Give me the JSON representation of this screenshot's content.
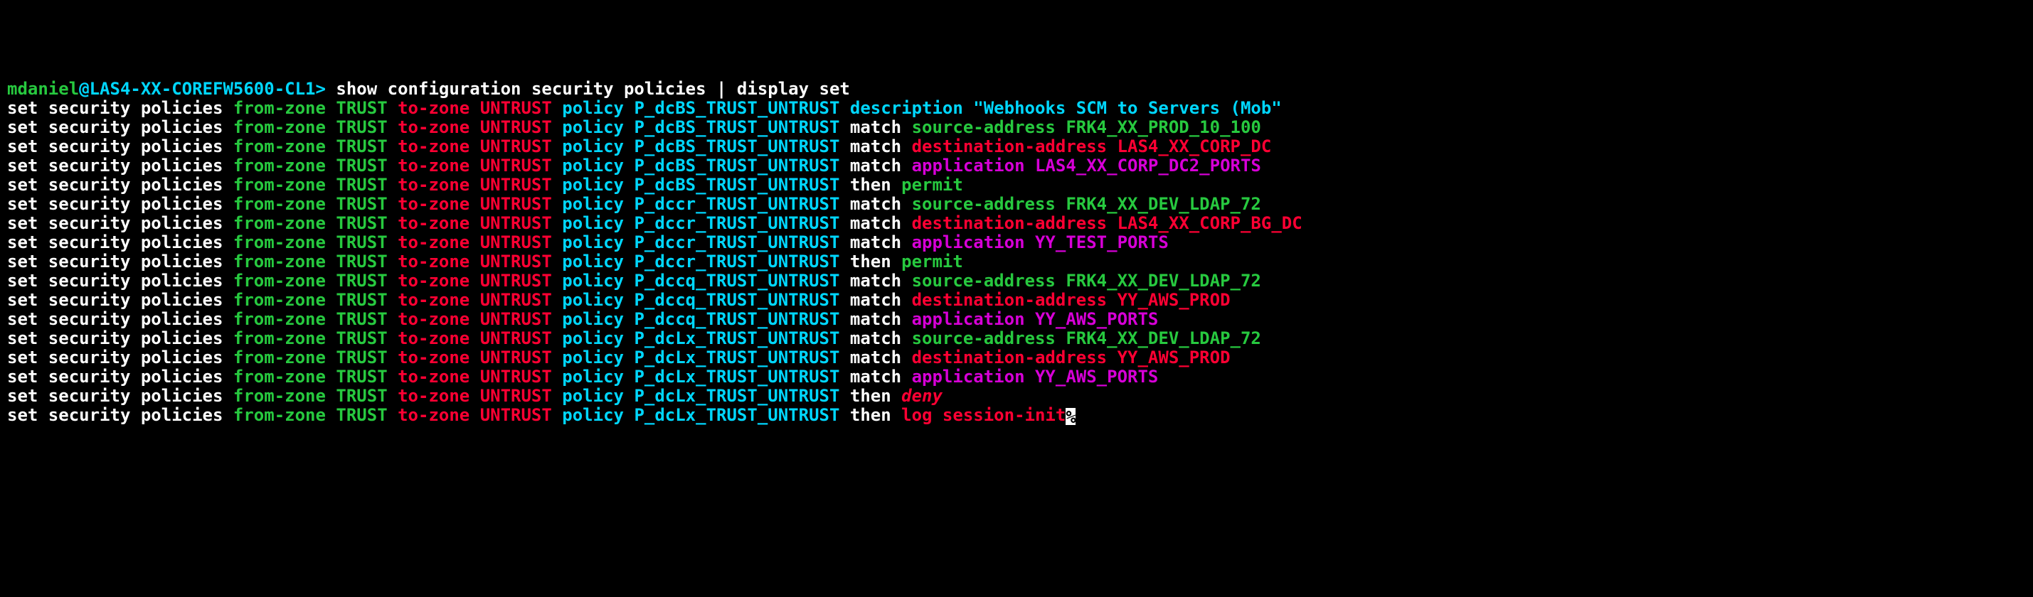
{
  "prompt": {
    "user": "mdaniel",
    "at": "@",
    "host": "LAS4-XX-COREFW5600-CL1",
    "caret": ">",
    "command": " show configuration security policies | display set"
  },
  "lines": [
    {
      "policy": "P_dcBS_TRUST_UNTRUST",
      "tail_kw": "description",
      "tail_val": "\"Webhooks SCM to Servers (Mob\"",
      "tail_kw_color": "cyan",
      "tail_val_color": "cyan"
    },
    {
      "policy": "P_dcBS_TRUST_UNTRUST",
      "mid": "match",
      "tail_kw": "source-address",
      "tail_val": "FRK4_XX_PROD_10_100",
      "tail_kw_color": "green",
      "tail_val_color": "green"
    },
    {
      "policy": "P_dcBS_TRUST_UNTRUST",
      "mid": "match",
      "tail_kw": "destination-address",
      "tail_val": "LAS4_XX_CORP_DC",
      "tail_kw_color": "red",
      "tail_val_color": "red"
    },
    {
      "policy": "P_dcBS_TRUST_UNTRUST",
      "mid": "match",
      "tail_kw": "application",
      "tail_val": "LAS4_XX_CORP_DC2_PORTS",
      "tail_kw_color": "magenta",
      "tail_val_color": "magenta"
    },
    {
      "policy": "P_dcBS_TRUST_UNTRUST",
      "mid": "then",
      "tail_kw": "permit",
      "tail_kw_color": "green"
    },
    {
      "policy": "P_dccr_TRUST_UNTRUST",
      "mid": "match",
      "tail_kw": "source-address",
      "tail_val": "FRK4_XX_DEV_LDAP_72",
      "tail_kw_color": "green",
      "tail_val_color": "green"
    },
    {
      "policy": "P_dccr_TRUST_UNTRUST",
      "mid": "match",
      "tail_kw": "destination-address",
      "tail_val": "LAS4_XX_CORP_BG_DC",
      "tail_kw_color": "red",
      "tail_val_color": "red"
    },
    {
      "policy": "P_dccr_TRUST_UNTRUST",
      "mid": "match",
      "tail_kw": "application",
      "tail_val": "YY_TEST_PORTS",
      "tail_kw_color": "magenta",
      "tail_val_color": "magenta"
    },
    {
      "policy": "P_dccr_TRUST_UNTRUST",
      "mid": "then",
      "tail_kw": "permit",
      "tail_kw_color": "green"
    },
    {
      "policy": "P_dccq_TRUST_UNTRUST",
      "mid": "match",
      "tail_kw": "source-address",
      "tail_val": "FRK4_XX_DEV_LDAP_72",
      "tail_kw_color": "green",
      "tail_val_color": "green"
    },
    {
      "policy": "P_dccq_TRUST_UNTRUST",
      "mid": "match",
      "tail_kw": "destination-address",
      "tail_val": "YY_AWS_PROD",
      "tail_kw_color": "red",
      "tail_val_color": "red"
    },
    {
      "policy": "P_dccq_TRUST_UNTRUST",
      "mid": "match",
      "tail_kw": "application",
      "tail_val": "YY_AWS_PORTS",
      "tail_kw_color": "magenta",
      "tail_val_color": "magenta"
    },
    {
      "policy": "P_dcLx_TRUST_UNTRUST",
      "mid": "match",
      "tail_kw": "source-address",
      "tail_val": "FRK4_XX_DEV_LDAP_72",
      "tail_kw_color": "green",
      "tail_val_color": "green"
    },
    {
      "policy": "P_dcLx_TRUST_UNTRUST",
      "mid": "match",
      "tail_kw": "destination-address",
      "tail_val": "YY_AWS_PROD",
      "tail_kw_color": "red",
      "tail_val_color": "red"
    },
    {
      "policy": "P_dcLx_TRUST_UNTRUST",
      "mid": "match",
      "tail_kw": "application",
      "tail_val": "YY_AWS_PORTS",
      "tail_kw_color": "magenta",
      "tail_val_color": "magenta"
    },
    {
      "policy": "P_dcLx_TRUST_UNTRUST",
      "mid": "then",
      "tail_kw": "deny",
      "tail_kw_color": "red-italic"
    },
    {
      "policy": "P_dcLx_TRUST_UNTRUST",
      "mid": "then",
      "tail_kw": "log session-init",
      "tail_kw_color": "red",
      "cursor": true
    }
  ],
  "common": {
    "set": "set",
    "security": "security",
    "policies": "policies",
    "from_zone": "from-zone",
    "trust": "TRUST",
    "to_zone": "to-zone",
    "untrust": "UNTRUST",
    "policy": "policy"
  }
}
